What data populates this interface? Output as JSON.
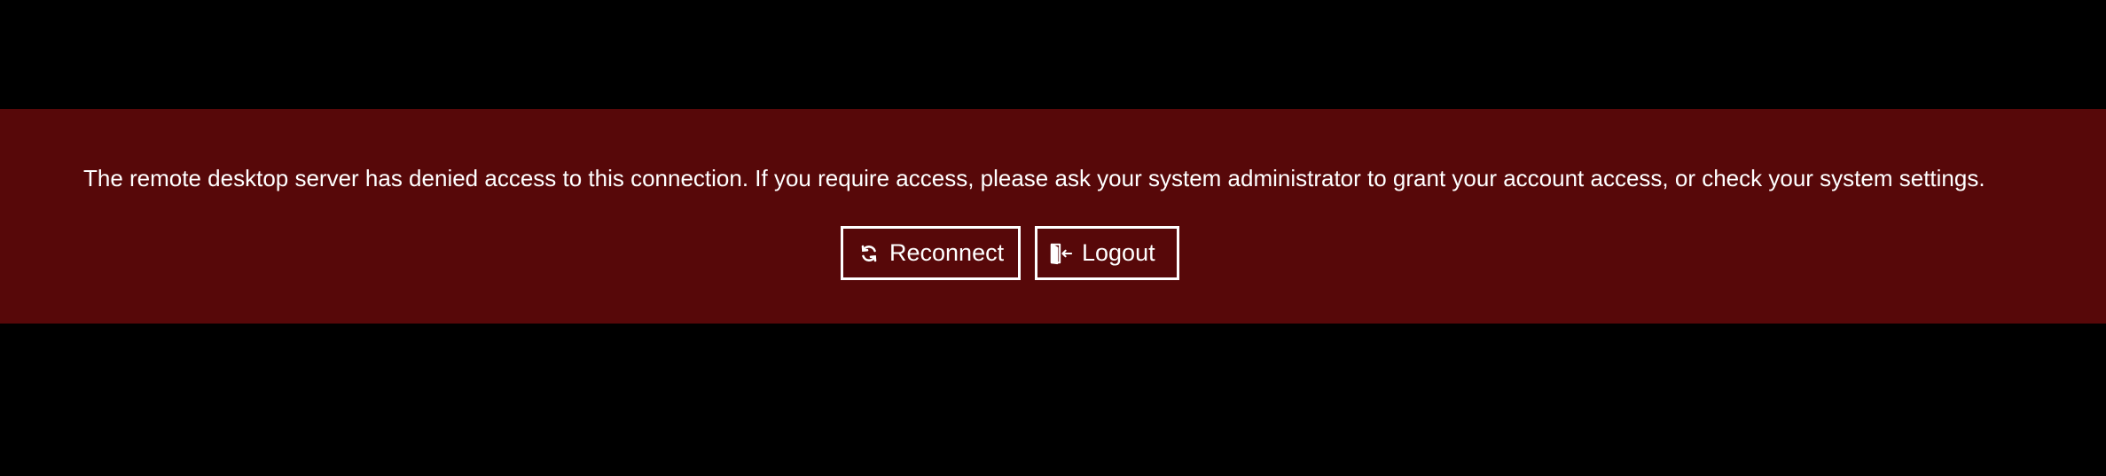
{
  "dialog": {
    "message": "The remote desktop server has denied access to this connection. If you require access, please ask your system administrator to grant your account access, or check your system settings.",
    "reconnect_label": "Reconnect",
    "reconnect_icon": "refresh-icon",
    "logout_label": "Logout",
    "logout_icon": "logout-door-icon"
  },
  "colors": {
    "background": "#000000",
    "banner": "#570809",
    "text": "#ffffff",
    "button_border": "#ffffff"
  }
}
